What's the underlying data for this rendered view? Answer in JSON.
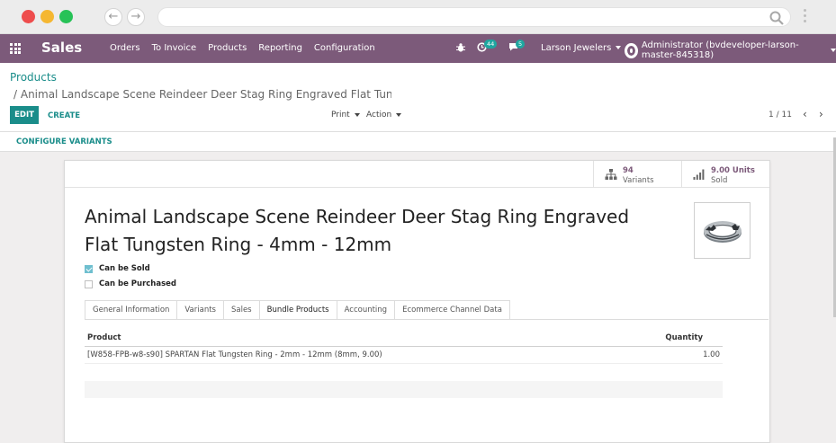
{
  "navbar": {
    "brand": "Sales",
    "menu": [
      "Orders",
      "To Invoice",
      "Products",
      "Reporting",
      "Configuration"
    ],
    "activity_count": "44",
    "message_count": "5",
    "company": "Larson Jewelers",
    "user": "Administrator (bvdeveloper-larson-master-845318)"
  },
  "breadcrumb": {
    "root": "Products",
    "current": "/ Animal Landscape Scene Reindeer Deer Stag Ring Engraved Flat Tungs…"
  },
  "toolbar": {
    "edit_label": "EDIT",
    "create_label": "CREATE",
    "print_label": "Print",
    "action_label": "Action",
    "pager": "1 / 11"
  },
  "configure_variants_label": "CONFIGURE VARIANTS",
  "stats": {
    "variants_value": "94",
    "variants_label": "Variants",
    "sold_value": "9.00 Units",
    "sold_label": "Sold"
  },
  "product": {
    "title": "Animal Landscape Scene Reindeer Deer Stag Ring Engraved Flat Tungsten Ring - 4mm - 12mm",
    "can_be_sold_label": "Can be Sold",
    "can_be_sold": true,
    "can_be_purchased_label": "Can be Purchased",
    "can_be_purchased": false
  },
  "tabs": [
    {
      "label": "General Information",
      "active": false
    },
    {
      "label": "Variants",
      "active": false
    },
    {
      "label": "Sales",
      "active": false
    },
    {
      "label": "Bundle Products",
      "active": true
    },
    {
      "label": "Accounting",
      "active": false
    },
    {
      "label": "Ecommerce Channel Data",
      "active": false
    }
  ],
  "bundle_table": {
    "columns": [
      "Product",
      "Quantity"
    ],
    "rows": [
      {
        "product": "[W858-FPB-w8-s90] SPARTAN Flat Tungsten Ring - 2mm - 12mm (8mm, 9.00)",
        "quantity": "1.00"
      }
    ]
  },
  "colors": {
    "navbar": "#7c5a7a",
    "accent": "#1a8d8a"
  }
}
